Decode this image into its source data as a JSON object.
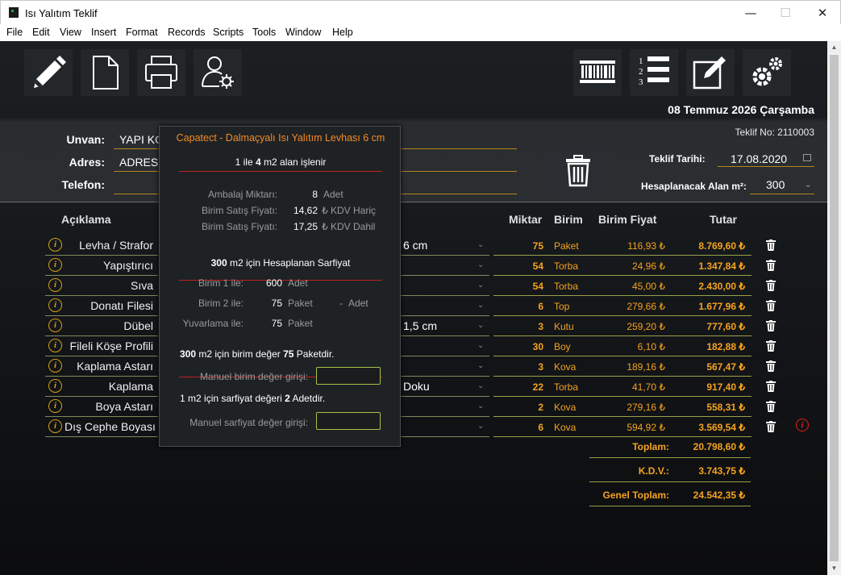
{
  "window": {
    "title": "Isı Yalıtım Teklif",
    "minimize": "—",
    "maximize": "☐",
    "close": "✕"
  },
  "menu": [
    "File",
    "Edit",
    "View",
    "Insert",
    "Format",
    "Records",
    "Scripts",
    "Tools",
    "Window",
    "Help"
  ],
  "toolbar": {
    "left": [
      "edit-icon",
      "new-document-icon",
      "print-icon",
      "user-settings-icon"
    ],
    "right": [
      "barcode-icon",
      "numbered-list-icon",
      "compose-icon",
      "settings-gear-icon"
    ]
  },
  "header": {
    "date": "08 Temmuz 2026 Çarşamba",
    "teklif_no": "Teklif No: 2110003",
    "teklif_tarihi_label": "Teklif Tarihi:",
    "teklif_tarihi": "17.08.2020",
    "alan_label": "Hesaplanacak Alan m²:",
    "alan": "300"
  },
  "form": {
    "unvan_label": "Unvan:",
    "unvan_value": "YAPI KO",
    "adres_label": "Adres:",
    "adres_value": "ADRES",
    "telefon_label": "Telefon:"
  },
  "table": {
    "headers": {
      "aciklama": "Açıklama",
      "miktar": "Miktar",
      "birim": "Birim",
      "birim_fiyat": "Birim Fiyat",
      "tutar": "Tutar"
    },
    "rows": [
      {
        "desc": "Levha / Strafor",
        "sel": "6 cm",
        "miktar": "75",
        "birim": "Paket",
        "fiyat": "116,93 ₺",
        "tutar": "8.769,60 ₺"
      },
      {
        "desc": "Yapıştırıcı",
        "sel": "",
        "miktar": "54",
        "birim": "Torba",
        "fiyat": "24,96 ₺",
        "tutar": "1.347,84 ₺"
      },
      {
        "desc": "Sıva",
        "sel": "",
        "miktar": "54",
        "birim": "Torba",
        "fiyat": "45,00 ₺",
        "tutar": "2.430,00 ₺"
      },
      {
        "desc": "Donatı Filesi",
        "sel": "",
        "miktar": "6",
        "birim": "Top",
        "fiyat": "279,66 ₺",
        "tutar": "1.677,96 ₺"
      },
      {
        "desc": "Dübel",
        "sel": "1,5 cm",
        "miktar": "3",
        "birim": "Kutu",
        "fiyat": "259,20 ₺",
        "tutar": "777,60 ₺"
      },
      {
        "desc": "Fileli Köşe Profili",
        "sel": "",
        "miktar": "30",
        "birim": "Boy",
        "fiyat": "6,10 ₺",
        "tutar": "182,88 ₺"
      },
      {
        "desc": "Kaplama Astarı",
        "sel": "",
        "miktar": "3",
        "birim": "Kova",
        "fiyat": "189,16 ₺",
        "tutar": "567,47 ₺"
      },
      {
        "desc": "Kaplama",
        "sel": "Doku",
        "miktar": "22",
        "birim": "Torba",
        "fiyat": "41,70 ₺",
        "tutar": "917,40 ₺"
      },
      {
        "desc": "Boya Astarı",
        "sel": "",
        "miktar": "2",
        "birim": "Kova",
        "fiyat": "279,16 ₺",
        "tutar": "558,31 ₺"
      },
      {
        "desc": "Dış Cephe Boyası",
        "sel": "",
        "miktar": "6",
        "birim": "Kova",
        "fiyat": "594,92 ₺",
        "tutar": "3.569,54 ₺"
      }
    ],
    "info_glyph": "i"
  },
  "totals": {
    "toplam_label": "Toplam:",
    "toplam": "20.798,60 ₺",
    "kdv_label": "K.D.V.:",
    "kdv": "3.743,75 ₺",
    "genel_label": "Genel Toplam:",
    "genel": "24.542,35 ₺"
  },
  "popup": {
    "title": "Capatect - Dalmaçyalı Isı Yalıtım Levhası 6 cm",
    "coverage_a": "1",
    "coverage_mid": "ile",
    "coverage_b": "4",
    "coverage_tail": "m2 alan işlenir",
    "ambalaj_label": "Ambalaj Miktarı:",
    "ambalaj_val": "8",
    "ambalaj_unit": "Adet",
    "satis_haric_label": "Birim Satış Fiyatı:",
    "satis_haric_val": "14,62",
    "satis_haric_unit": "₺ KDV Hariç",
    "satis_dahil_label": "Birim Satış Fiyatı:",
    "satis_dahil_val": "17,25",
    "satis_dahil_unit": "₺ KDV Dahil",
    "sarfiyat_area": "300",
    "sarfiyat_title": "m2 için Hesaplanan Sarfiyat",
    "birim1_label": "Birim 1 ile:",
    "birim1_val": "600",
    "birim1_unit": "Adet",
    "birim2_label": "Birim 2 ile:",
    "birim2_val": "75",
    "birim2_unit": "Paket",
    "birim2_dash": "-",
    "birim2_unit2": "Adet",
    "yuvarlama_label": "Yuvarlama ile:",
    "yuvarlama_val": "75",
    "yuvarlama_unit": "Paket",
    "summary_area": "300",
    "summary_mid": "m2 için birim değer",
    "summary_val": "75",
    "summary_tail": "Paketdir.",
    "manuel_birim_label": "Manuel birim değer girişi:",
    "sarf_a": "1",
    "sarf_mid": "m2 için sarfiyat değeri",
    "sarf_val": "2",
    "sarf_tail": "Adetdir.",
    "manuel_sarf_label": "Manuel sarfiyat değer girişi:"
  },
  "colors": {
    "accent": "#f5a31f",
    "popup_title": "#f58a24",
    "line": "#b8841e",
    "warn": "#e0201c"
  }
}
